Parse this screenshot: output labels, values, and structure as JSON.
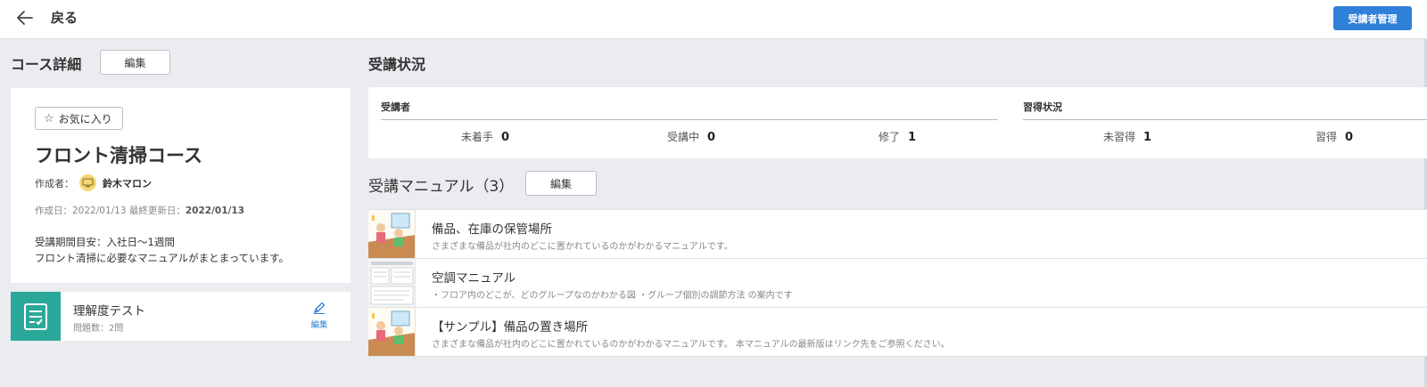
{
  "header": {
    "back_label": "戻る",
    "manage_button": "受講者管理"
  },
  "course_detail": {
    "section_title": "コース詳細",
    "edit_label": "編集",
    "favorite_label": "お気に入り",
    "course_title": "フロント清掃コース",
    "author_label": "作成者：",
    "author_name": "鈴木マロン",
    "created_label": "作成日：2022/01/13 最終更新日：",
    "updated_date": "2022/01/13",
    "desc_line1": "受講期間目安：入社日〜1週間",
    "desc_line2": "フロント清掃に必要なマニュアルがまとまっています。"
  },
  "test": {
    "title": "理解度テスト",
    "subtitle": "問題数：2問",
    "edit_label": "編集"
  },
  "status": {
    "section_title": "受講状況",
    "learners_label": "受講者",
    "mastery_label": "習得状況",
    "learners": [
      {
        "label": "未着手",
        "value": "0"
      },
      {
        "label": "受講中",
        "value": "0"
      },
      {
        "label": "修了",
        "value": "1"
      }
    ],
    "mastery": [
      {
        "label": "未習得",
        "value": "1"
      },
      {
        "label": "習得",
        "value": "0"
      }
    ]
  },
  "manuals": {
    "section_title": "受講マニュアル（3）",
    "edit_label": "編集",
    "items": [
      {
        "title": "備品、在庫の保管場所",
        "desc": "さまざまな備品が社内のどこに置かれているのかがわかるマニュアルです。",
        "thumb": "office-illustration"
      },
      {
        "title": "空調マニュアル",
        "desc": "・フロア内のどこが、どのグループなのかわかる図 ・グループ個別の調節方法 の案内です",
        "thumb": "document-preview"
      },
      {
        "title": "【サンプル】備品の置き場所",
        "desc": "さまざまな備品が社内のどこに置かれているのかがわかるマニュアルです。 本マニュアルの最新版はリンク先をご参照ください。",
        "thumb": "office-illustration"
      }
    ]
  },
  "colors": {
    "accent": "#2f80d9",
    "test_icon_bg": "#2aa89a",
    "page_bg": "#eaecf0"
  }
}
